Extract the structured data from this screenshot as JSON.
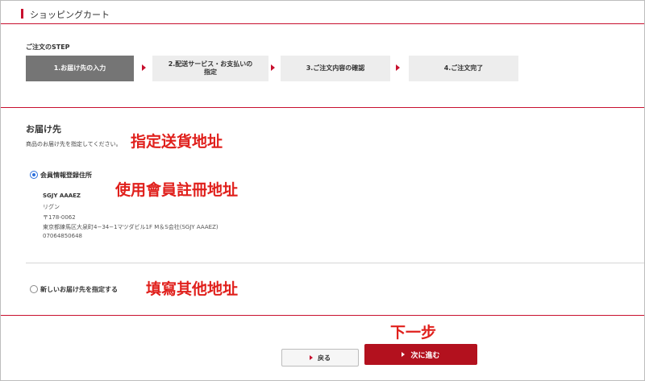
{
  "header": {
    "title": "ショッピングカート"
  },
  "steps": {
    "caption": "ご注文のSTEP",
    "items": [
      {
        "label": "1.お届け先の入力"
      },
      {
        "label": "2.配送サービス・お支払いの\n指定"
      },
      {
        "label": "3.ご注文内容の確認"
      },
      {
        "label": "4.ご注文完了"
      }
    ]
  },
  "delivery": {
    "title": "お届け先",
    "description": "商品のお届け先を指定してください。",
    "option_member": {
      "label": "会員情報登録住所",
      "name": "SGJY AAAEZ",
      "kana": "リグン",
      "postal": "〒178-0062",
      "address": "東京都練馬区大泉町4−34−1マツダビル1F M＆S会社(SGJY AAAEZ)",
      "phone": "07064850648"
    },
    "option_new": {
      "label": "新しいお届け先を指定する"
    }
  },
  "annotations": {
    "specify_address": "指定送貨地址",
    "use_member_address": "使用會員註冊地址",
    "other_address": "填寫其他地址",
    "next_step": "下一步"
  },
  "buttons": {
    "back": "戻る",
    "next": "次に進む"
  },
  "colors": {
    "accent": "#c8102e",
    "next_button": "#b3111e",
    "annotation": "#e0201c"
  }
}
